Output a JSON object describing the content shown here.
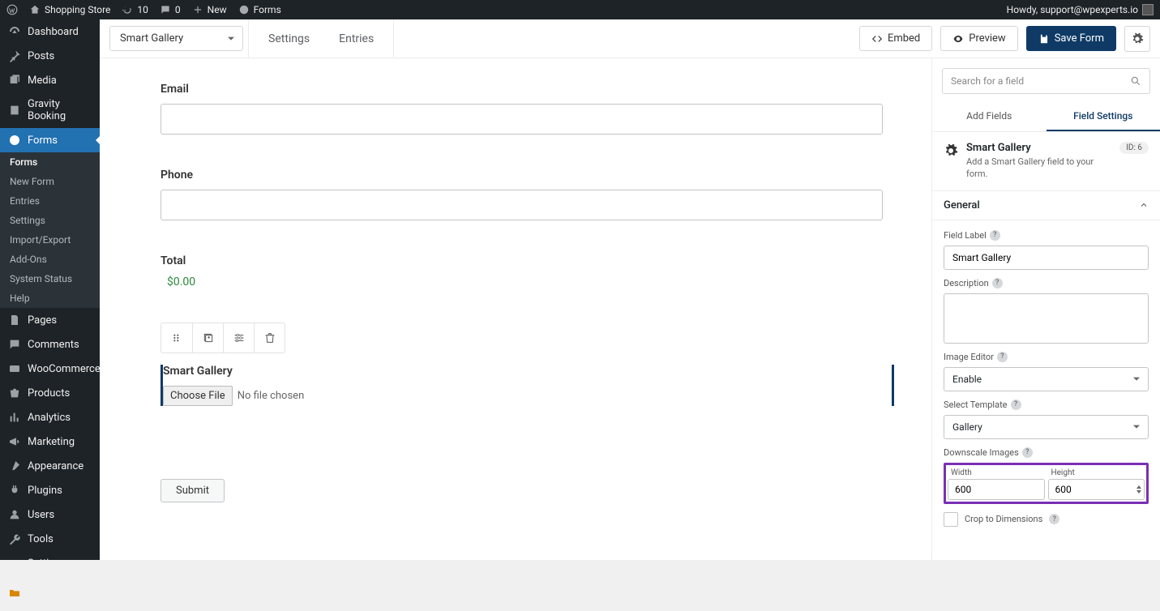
{
  "adminbar": {
    "site": "Shopping Store",
    "refresh": "10",
    "comments": "0",
    "new": "New",
    "forms": "Forms",
    "howdy": "Howdy, support@wpexperts.io"
  },
  "sidebar": {
    "dashboard": "Dashboard",
    "posts": "Posts",
    "media": "Media",
    "gravity": "Gravity Booking",
    "forms": "Forms",
    "submenu": {
      "forms": "Forms",
      "newform": "New Form",
      "entries": "Entries",
      "settings": "Settings",
      "import": "Import/Export",
      "addons": "Add-Ons",
      "status": "System Status",
      "help": "Help"
    },
    "pages": "Pages",
    "commentsL": "Comments",
    "woo": "WooCommerce",
    "products": "Products",
    "analytics": "Analytics",
    "marketing": "Marketing",
    "appearance": "Appearance",
    "plugins": "Plugins",
    "users": "Users",
    "tools": "Tools",
    "settings": "Settings",
    "filemgr": "WP File Manager"
  },
  "topbar": {
    "form_select": "Smart Gallery",
    "settings": "Settings",
    "entries": "Entries",
    "embed": "Embed",
    "preview": "Preview",
    "save": "Save Form"
  },
  "canvas": {
    "email": "Email",
    "phone": "Phone",
    "total": "Total",
    "total_val": "$0.00",
    "gallery_label": "Smart Gallery",
    "choose_file": "Choose File",
    "no_file": "No file chosen",
    "submit": "Submit"
  },
  "panel": {
    "search_placeholder": "Search for a field",
    "tabs": {
      "add": "Add Fields",
      "settings": "Field Settings"
    },
    "field_name": "Smart Gallery",
    "field_desc": "Add a Smart Gallery field to your form.",
    "id_badge": "ID: 6",
    "section": "General",
    "labels": {
      "field_label": "Field Label",
      "description": "Description",
      "image_editor": "Image Editor",
      "select_template": "Select Template",
      "downscale": "Downscale Images",
      "width": "Width",
      "height": "Height",
      "crop": "Crop to Dimensions"
    },
    "values": {
      "field_label": "Smart Gallery",
      "image_editor": "Enable",
      "template": "Gallery",
      "width": "600",
      "height": "600"
    }
  }
}
